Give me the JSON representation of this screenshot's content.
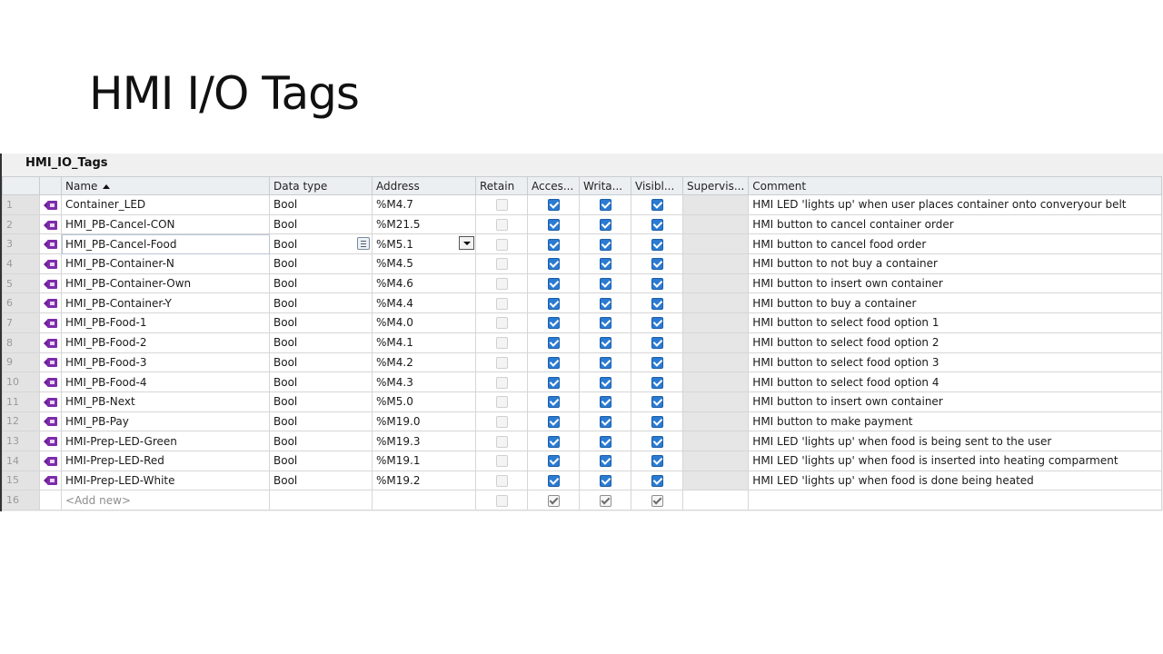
{
  "slide": {
    "title": "HMI I/O Tags"
  },
  "table": {
    "title": "HMI_IO_Tags",
    "columns": {
      "name": "Name",
      "datatype": "Data type",
      "address": "Address",
      "retain": "Retain",
      "accessible": "Acces...",
      "writable": "Writa...",
      "visible": "Visibl...",
      "supervision": "Supervis...",
      "comment": "Comment"
    },
    "sort": {
      "column": "Name",
      "direction": "ascending"
    },
    "selected_row": 3,
    "rows": [
      {
        "num": "1",
        "name": "Container_LED",
        "datatype": "Bool",
        "address": "%M4.7",
        "retain": false,
        "accessible": true,
        "writable": true,
        "visible": true,
        "comment": "HMI LED 'lights up' when user places container onto converyour belt"
      },
      {
        "num": "2",
        "name": "HMI_PB-Cancel-CON",
        "datatype": "Bool",
        "address": "%M21.5",
        "retain": false,
        "accessible": true,
        "writable": true,
        "visible": true,
        "comment": "HMI button to cancel container order"
      },
      {
        "num": "3",
        "name": "HMI_PB-Cancel-Food",
        "datatype": "Bool",
        "address": "%M5.1",
        "retain": false,
        "accessible": true,
        "writable": true,
        "visible": true,
        "comment": "HMI button to cancel food order"
      },
      {
        "num": "4",
        "name": "HMI_PB-Container-N",
        "datatype": "Bool",
        "address": "%M4.5",
        "retain": false,
        "accessible": true,
        "writable": true,
        "visible": true,
        "comment": "HMI button to not buy a container"
      },
      {
        "num": "5",
        "name": "HMI_PB-Container-Own",
        "datatype": "Bool",
        "address": "%M4.6",
        "retain": false,
        "accessible": true,
        "writable": true,
        "visible": true,
        "comment": "HMI button to insert own container"
      },
      {
        "num": "6",
        "name": "HMI_PB-Container-Y",
        "datatype": "Bool",
        "address": "%M4.4",
        "retain": false,
        "accessible": true,
        "writable": true,
        "visible": true,
        "comment": "HMI button to buy a container"
      },
      {
        "num": "7",
        "name": "HMI_PB-Food-1",
        "datatype": "Bool",
        "address": "%M4.0",
        "retain": false,
        "accessible": true,
        "writable": true,
        "visible": true,
        "comment": "HMI button to select food option 1"
      },
      {
        "num": "8",
        "name": "HMI_PB-Food-2",
        "datatype": "Bool",
        "address": "%M4.1",
        "retain": false,
        "accessible": true,
        "writable": true,
        "visible": true,
        "comment": "HMI button to select food option 2"
      },
      {
        "num": "9",
        "name": "HMI_PB-Food-3",
        "datatype": "Bool",
        "address": "%M4.2",
        "retain": false,
        "accessible": true,
        "writable": true,
        "visible": true,
        "comment": "HMI button to select food option 3"
      },
      {
        "num": "10",
        "name": "HMI_PB-Food-4",
        "datatype": "Bool",
        "address": "%M4.3",
        "retain": false,
        "accessible": true,
        "writable": true,
        "visible": true,
        "comment": "HMI button to select food option 4"
      },
      {
        "num": "11",
        "name": "HMI_PB-Next",
        "datatype": "Bool",
        "address": "%M5.0",
        "retain": false,
        "accessible": true,
        "writable": true,
        "visible": true,
        "comment": "HMI button to insert own container"
      },
      {
        "num": "12",
        "name": "HMI_PB-Pay",
        "datatype": "Bool",
        "address": "%M19.0",
        "retain": false,
        "accessible": true,
        "writable": true,
        "visible": true,
        "comment": "HMI button to make payment"
      },
      {
        "num": "13",
        "name": "HMI-Prep-LED-Green",
        "datatype": "Bool",
        "address": "%M19.3",
        "retain": false,
        "accessible": true,
        "writable": true,
        "visible": true,
        "comment": "HMI LED 'lights up' when food is being sent to the user"
      },
      {
        "num": "14",
        "name": "HMI-Prep-LED-Red",
        "datatype": "Bool",
        "address": "%M19.1",
        "retain": false,
        "accessible": true,
        "writable": true,
        "visible": true,
        "comment": "HMI LED 'lights up' when food is inserted into heating comparment"
      },
      {
        "num": "15",
        "name": "HMI-Prep-LED-White",
        "datatype": "Bool",
        "address": "%M19.2",
        "retain": false,
        "accessible": true,
        "writable": true,
        "visible": true,
        "comment": "HMI LED 'lights up' when food is done being heated"
      }
    ],
    "add_row": {
      "num": "16",
      "placeholder": "<Add new>",
      "retain": false,
      "accessible": true,
      "writable": true,
      "visible": true
    },
    "icons": {
      "tag": "hmi-tag-icon",
      "list": "list-icon",
      "dropdown": "dropdown-arrow-icon"
    },
    "colors": {
      "checkbox_checked": "#2b7bd3",
      "tag_icon": "#7d2bab",
      "panel_bg": "#f0f0f0"
    }
  }
}
